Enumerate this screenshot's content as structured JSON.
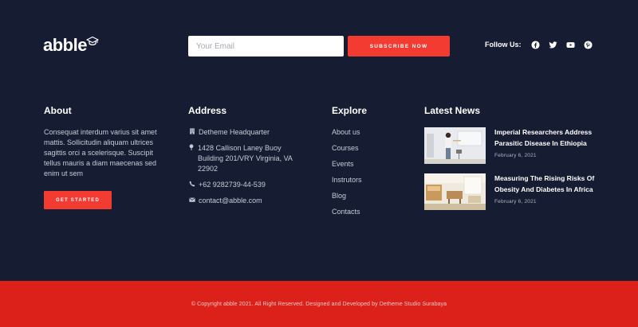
{
  "brand": {
    "name": "abble"
  },
  "subscribe": {
    "placeholder": "Your Email",
    "button_label": "SUBSCRIBE NOW"
  },
  "social": {
    "label": "Follow Us:",
    "icons": [
      "facebook-icon",
      "twitter-icon",
      "youtube-icon",
      "pinterest-icon"
    ]
  },
  "about": {
    "title": "About",
    "text": "Consequat interdum varius sit amet mattis. Sollicitudin aliquam ultrices sagittis orci a scelerisque. Suscipit tellus mauris a diam maecenas sed enim ut sem",
    "button_label": "GET STARTED"
  },
  "address": {
    "title": "Address",
    "items": [
      {
        "icon": "building-icon",
        "text": "Detheme Headquarter"
      },
      {
        "icon": "map-pin-icon",
        "text": "1428 Callison Laney Buoy Building 201/VRY Virginia, VA 22902"
      },
      {
        "icon": "phone-icon",
        "text": "+62 9282739-44-539"
      },
      {
        "icon": "envelope-icon",
        "text": "contact@abble.com"
      }
    ]
  },
  "explore": {
    "title": "Explore",
    "links": [
      "About us",
      "Courses",
      "Events",
      "Instrutors",
      "Blog",
      "Contacts"
    ]
  },
  "news": {
    "title": "Latest News",
    "items": [
      {
        "title": "Imperial Researchers Address Parasitic Disease In Ethiopia",
        "date": "February 6, 2021"
      },
      {
        "title": "Measuring The Rising Risks Of Obesity And Diabetes In Africa",
        "date": "February 6, 2021"
      }
    ]
  },
  "copyright": "© Copyright abble 2021. All Right Reserved. Designed and Developed by Detheme Studio Surabaya",
  "colors": {
    "footer_bg": "#161d33",
    "accent": "#f43b32",
    "bottom_bar": "#dc211b"
  }
}
